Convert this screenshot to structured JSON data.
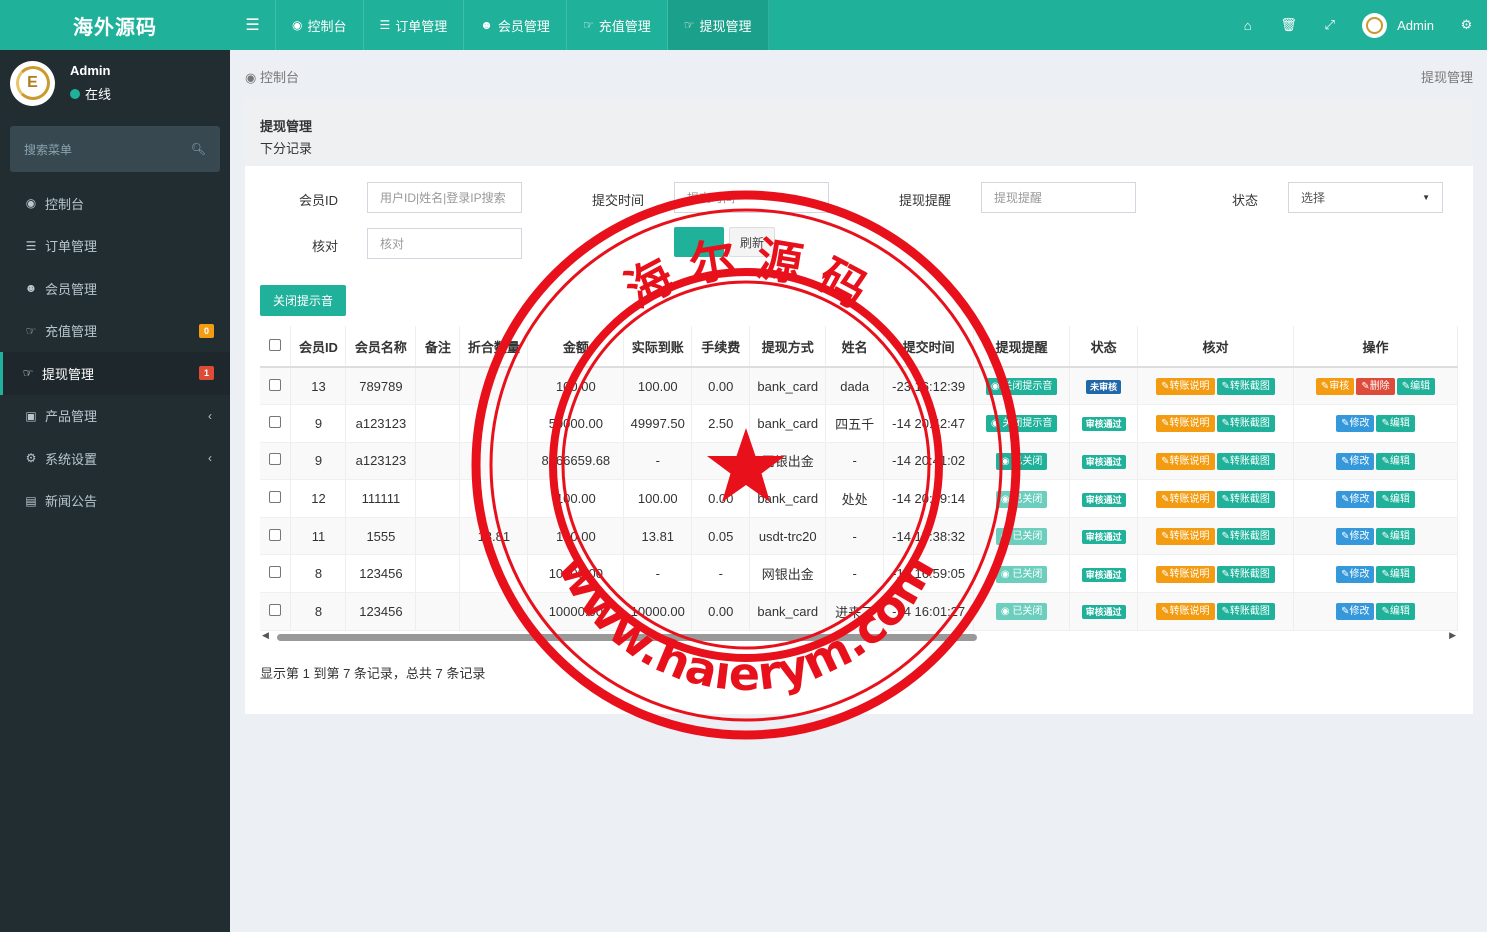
{
  "brand": {
    "title": "海外源码"
  },
  "user": {
    "name": "Admin",
    "status": "在线"
  },
  "sidebar": {
    "search_placeholder": "搜索菜单",
    "items": [
      {
        "icon": "dashboard-icon",
        "label": "控制台"
      },
      {
        "icon": "list-icon",
        "label": "订单管理"
      },
      {
        "icon": "users-icon",
        "label": "会员管理"
      },
      {
        "icon": "hand-icon",
        "label": "充值管理",
        "badge": "0"
      },
      {
        "icon": "hand-icon",
        "label": "提现管理",
        "badge": "1"
      },
      {
        "icon": "shopping-bag-icon",
        "label": "产品管理"
      },
      {
        "icon": "cogs-icon",
        "label": "系统设置"
      },
      {
        "icon": "newspaper-icon",
        "label": "新闻公告"
      }
    ]
  },
  "topnav": {
    "tabs": [
      "控制台",
      "订单管理",
      "会员管理",
      "充值管理",
      "提现管理"
    ],
    "user_name": "Admin"
  },
  "breadcrumb": {
    "left": "控制台",
    "right": "提现管理"
  },
  "panel": {
    "title": "提现管理",
    "subtitle": "下分记录"
  },
  "filters": {
    "member_id_label": "会员ID",
    "member_id_placeholder": "用户ID|姓名|登录IP搜索",
    "submit_time_label": "提交时间",
    "submit_time_placeholder": "提交时间",
    "reminder_label": "提现提醒",
    "reminder_placeholder": "提现提醒",
    "status_label": "状态",
    "status_value": "选择",
    "check_label": "核对",
    "check_placeholder": "核对",
    "search_button": "搜索",
    "refresh_button": "刷新"
  },
  "close_sound_button": "关闭提示音",
  "table": {
    "headers": [
      "会员ID",
      "会员名称",
      "备注",
      "折合数量",
      "金额",
      "实际到账",
      "手续费",
      "提现方式",
      "姓名",
      "提交时间",
      "提现提醒",
      "状态",
      "核对",
      "操作"
    ],
    "rows": [
      {
        "id": "13",
        "name": "789789",
        "note": "",
        "qty": "",
        "amount": "100.00",
        "actual": "100.00",
        "fee": "0.00",
        "method": "bank_card",
        "realname": "dada",
        "time": "-23 16:12:39",
        "reminder": "关闭提示音",
        "reminder_style": "teal",
        "status": "未审核",
        "status_style": "blue",
        "ops": [
          "审核",
          "删除",
          "编辑"
        ]
      },
      {
        "id": "9",
        "name": "a123123",
        "note": "",
        "qty": "",
        "amount": "50000.00",
        "actual": "49997.50",
        "fee": "2.50",
        "method": "bank_card",
        "realname": "四五千",
        "time": "-14 20:42:47",
        "reminder": "关闭提示音",
        "reminder_style": "teal",
        "status": "审核通过",
        "status_style": "teal",
        "ops": [
          "修改",
          "编辑"
        ]
      },
      {
        "id": "9",
        "name": "a123123",
        "note": "",
        "qty": "",
        "amount": "8866659.68",
        "actual": "-",
        "fee": "-",
        "method": "网银出金",
        "realname": "-",
        "time": "-14 20:41:02",
        "reminder": "已关闭",
        "reminder_style": "teal",
        "status": "审核通过",
        "status_style": "teal",
        "ops": [
          "修改",
          "编辑"
        ]
      },
      {
        "id": "12",
        "name": "111111",
        "note": "",
        "qty": "",
        "amount": "100.00",
        "actual": "100.00",
        "fee": "0.00",
        "method": "bank_card",
        "realname": "处处",
        "time": "-14 20:39:14",
        "reminder": "已关闭",
        "reminder_style": "teal-l",
        "status": "审核通过",
        "status_style": "teal",
        "ops": [
          "修改",
          "编辑"
        ]
      },
      {
        "id": "11",
        "name": "1555",
        "note": "",
        "qty": "13.81",
        "amount": "100.00",
        "actual": "13.81",
        "fee": "0.05",
        "method": "usdt-trc20",
        "realname": "-",
        "time": "-14 17:38:32",
        "reminder": "已关闭",
        "reminder_style": "teal-l",
        "status": "审核通过",
        "status_style": "teal",
        "ops": [
          "修改",
          "编辑"
        ]
      },
      {
        "id": "8",
        "name": "123456",
        "note": "",
        "qty": "",
        "amount": "10000.00",
        "actual": "-",
        "fee": "-",
        "method": "网银出金",
        "realname": "-",
        "time": "-14 16:59:05",
        "reminder": "已关闭",
        "reminder_style": "teal-l",
        "status": "审核通过",
        "status_style": "teal",
        "ops": [
          "修改",
          "编辑"
        ]
      },
      {
        "id": "8",
        "name": "123456",
        "note": "",
        "qty": "",
        "amount": "10000.00",
        "actual": "10000.00",
        "fee": "0.00",
        "method": "bank_card",
        "realname": "进来了",
        "time": "-14 16:01:27",
        "reminder": "已关闭",
        "reminder_style": "teal-l",
        "status": "审核通过",
        "status_style": "teal",
        "ops": [
          "修改",
          "编辑"
        ]
      }
    ],
    "check_buttons": [
      "转账说明",
      "转账截图"
    ]
  },
  "footer_info": "显示第 1 到第 7 条记录，总共 7 条记录",
  "watermark": {
    "top_text": "海 尔 源 码",
    "bottom_text": "www.haierym.com"
  },
  "colors": {
    "accent": "#1fb19a",
    "sidebar": "#222d32",
    "stamp": "#e8101a"
  }
}
